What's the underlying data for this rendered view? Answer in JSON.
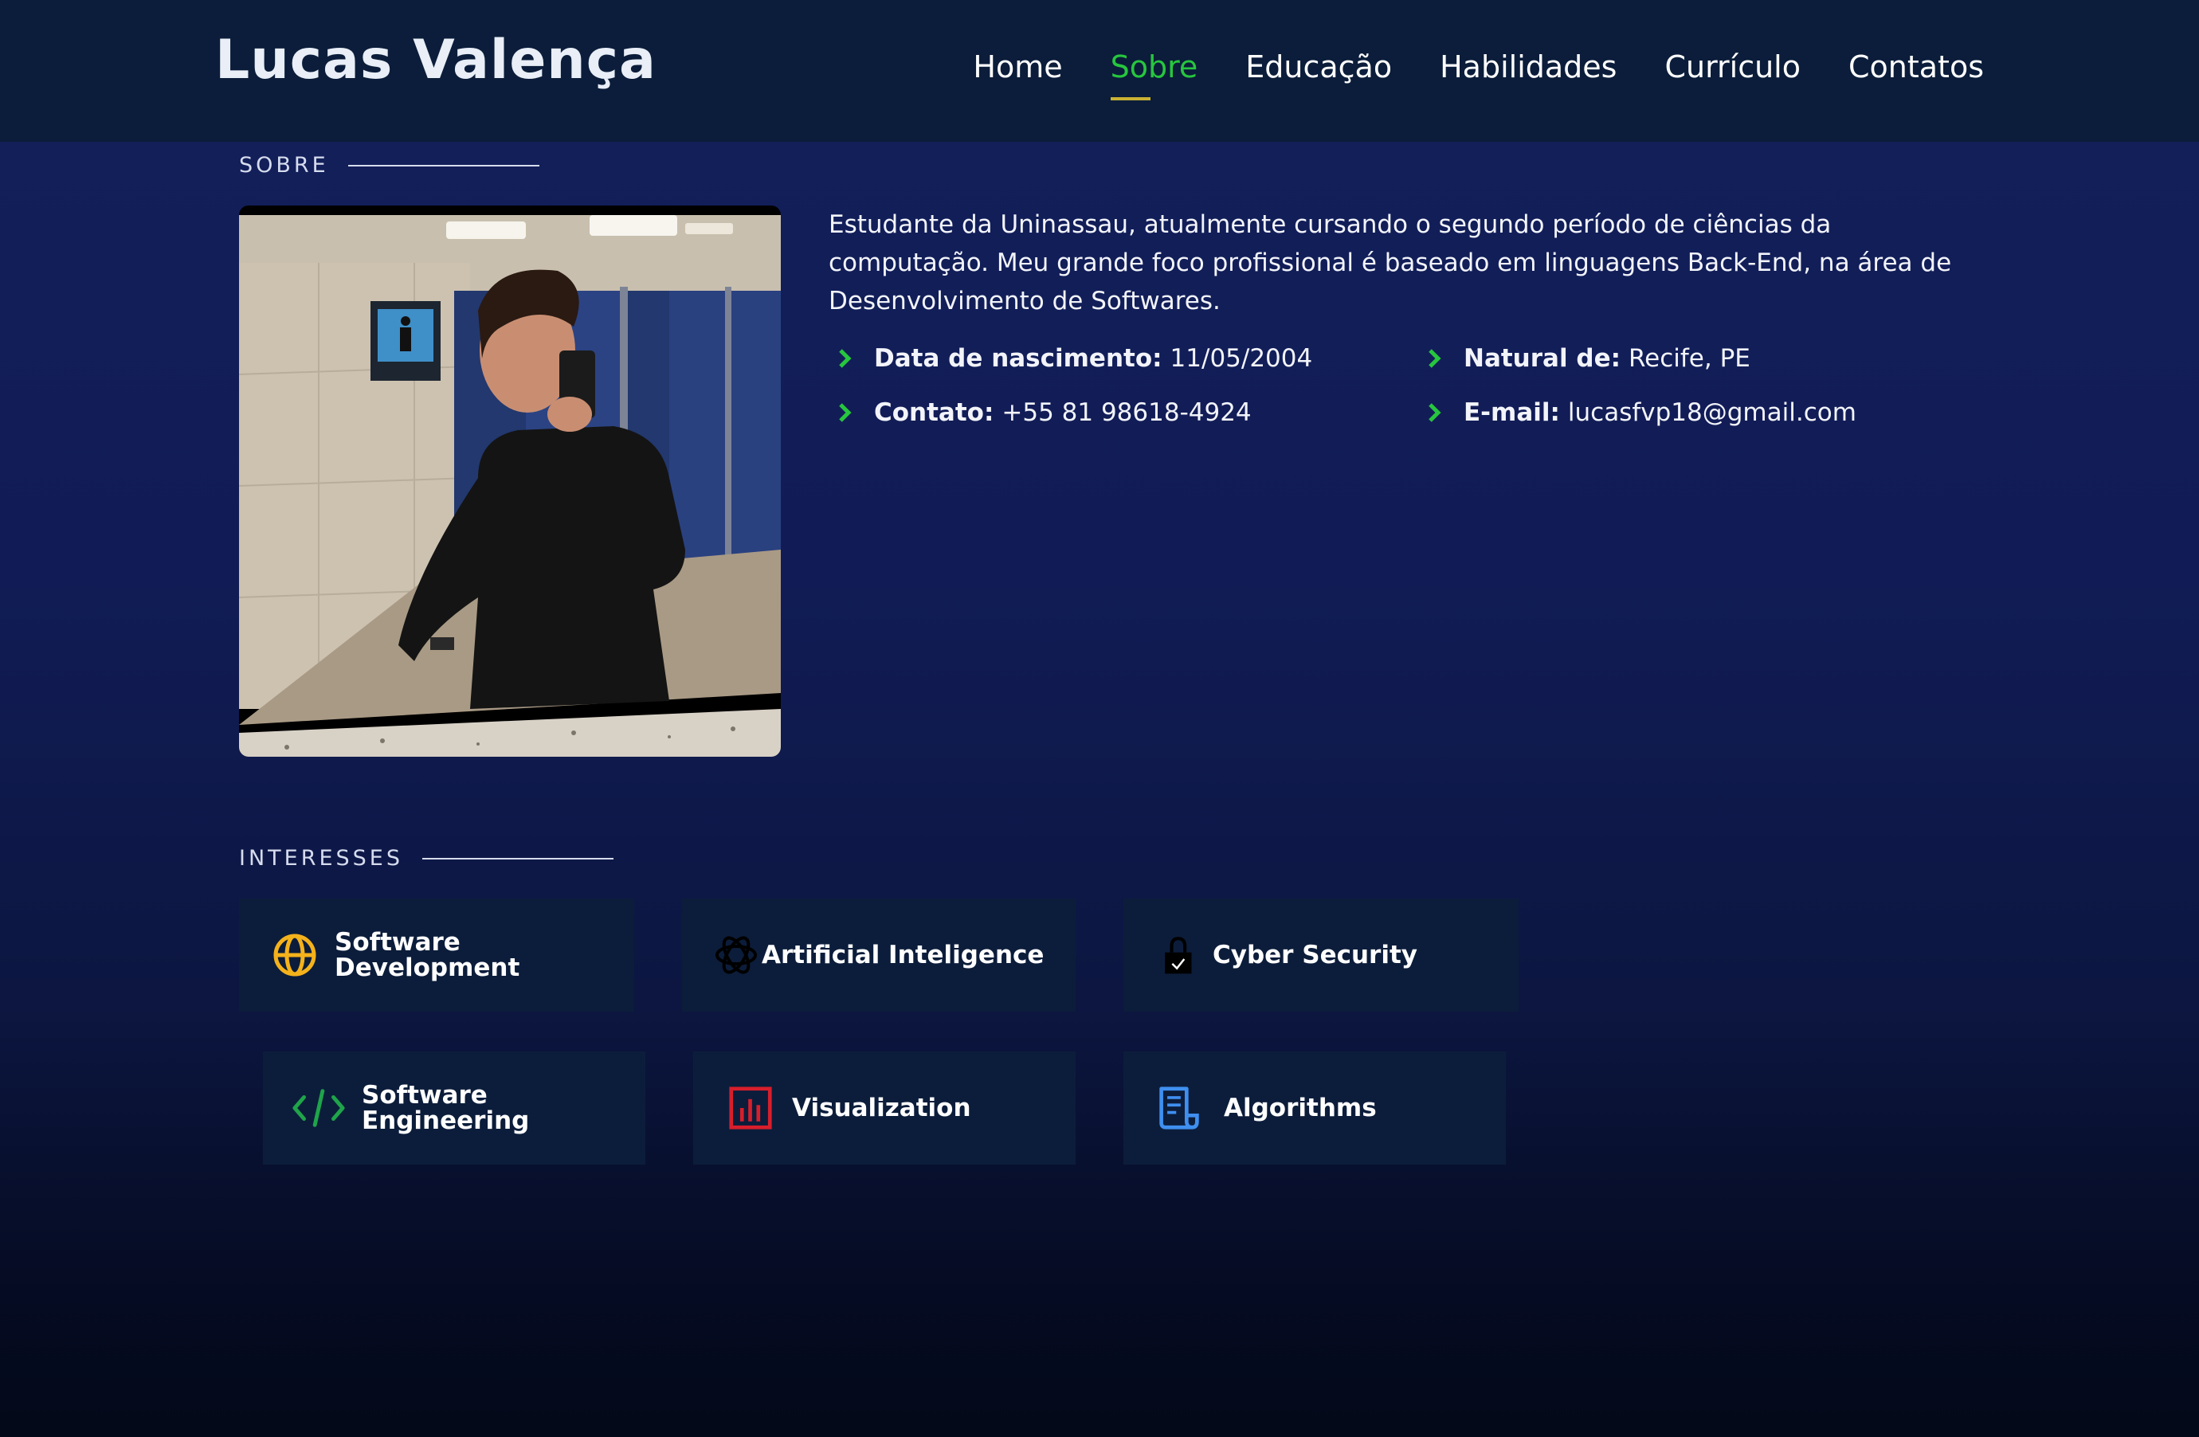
{
  "brand": "Lucas Valença",
  "nav": [
    "Home",
    "Sobre",
    "Educação",
    "Habilidades",
    "Currículo",
    "Contatos"
  ],
  "about": {
    "heading": "SOBRE",
    "text": "Estudante da Uninassau, atualmente cursando o segundo período de ciências da computação. Meu grande foco profissional é baseado em linguagens Back-End, na área de Desenvolvimento de Softwares.",
    "facts": [
      {
        "label": "Data de nascimento:",
        "value": "11/05/2004"
      },
      {
        "label": "Natural de:",
        "value": "Recife, PE"
      },
      {
        "label": "Contato:",
        "value": "+55 81 98618-4924"
      },
      {
        "label": "E-mail:",
        "value": "lucasfvp18@gmail.com"
      }
    ]
  },
  "interests": {
    "heading": "INTERESSES",
    "items": [
      {
        "label_1": "Software",
        "label_2": "Development",
        "icon": "globe-icon"
      },
      {
        "label_1": "Artificial Inteligence",
        "label_2": "",
        "icon": "openai-icon"
      },
      {
        "label_1": "Cyber Security",
        "label_2": "",
        "icon": "lock-icon"
      },
      {
        "label_1": "Software",
        "label_2": "Engineering",
        "icon": "code-icon"
      },
      {
        "label_1": "Visualization",
        "label_2": "",
        "icon": "bar-chart-icon"
      },
      {
        "label_1": "Algorithms",
        "label_2": "",
        "icon": "document-icon"
      }
    ]
  },
  "colors": {
    "accent_green": "#27c63e",
    "header_bg": "#0b1d3a",
    "card_bg": "#0c1d3b",
    "nav_underline": "#c9b233",
    "globe": "#f4b21b",
    "code": "#1fa44a",
    "chart": "#d81e2b",
    "doc": "#3f8ff0"
  }
}
